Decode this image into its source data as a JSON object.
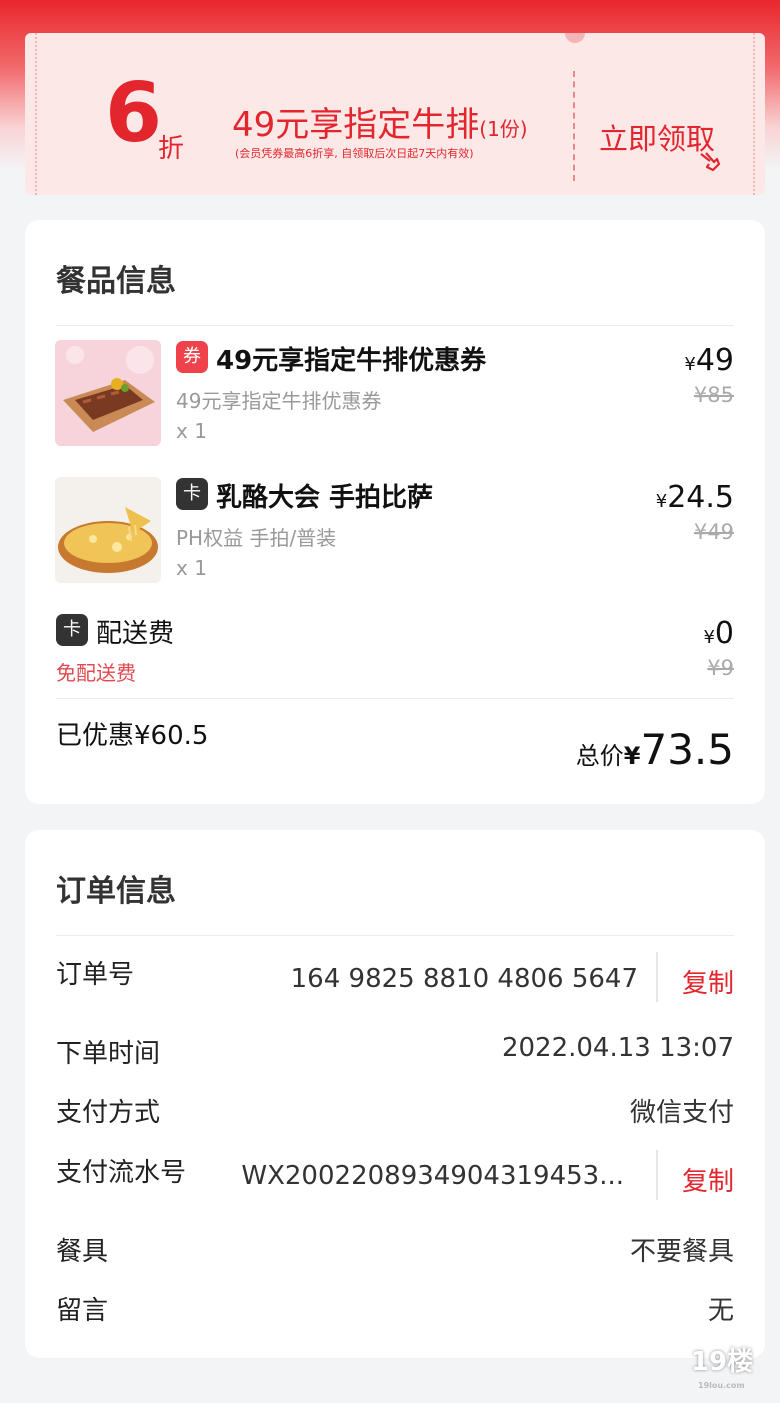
{
  "coupon": {
    "discount": "6",
    "discount_unit": "折",
    "title": "49元享指定牛排",
    "title_qty": "(1份)",
    "note": "(会员凭券最高6折享, 自领取后次日起7天内有效)",
    "claim_label": "立即领取"
  },
  "food": {
    "title": "餐品信息",
    "items": [
      {
        "badge": "券",
        "name": "49元享指定牛排优惠券",
        "subtitle": "49元享指定牛排优惠券",
        "qty": "x 1",
        "currency": "¥",
        "price": "49",
        "original_price": "¥85"
      },
      {
        "badge": "卡",
        "name": "乳酪大会 手拍比萨",
        "subtitle": "PH权益 手拍/普装",
        "qty": "x 1",
        "currency": "¥",
        "price": "24.5",
        "original_price": "¥49"
      }
    ],
    "delivery": {
      "badge": "卡",
      "name": "配送费",
      "note": "免配送费",
      "currency": "¥",
      "price": "0",
      "original_price": "¥9"
    },
    "saved": "已优惠¥60.5",
    "total_label": "总价",
    "total_currency": "¥",
    "total": "73.5"
  },
  "order": {
    "title": "订单信息",
    "order_no_label": "订单号",
    "order_no": "164 9825 8810 4806 5647",
    "copy_label": "复制",
    "time_label": "下单时间",
    "time": "2022.04.13 13:07",
    "pay_method_label": "支付方式",
    "pay_method": "微信支付",
    "pay_serial_label": "支付流水号",
    "pay_serial": "WX2002208934904319453...",
    "tableware_label": "餐具",
    "tableware": "不要餐具",
    "message_label": "留言",
    "message": "无"
  },
  "watermark": {
    "logo": "19楼",
    "domain": "19lou.com"
  },
  "colors": {
    "accent": "#e3262d",
    "card": "#ffffff",
    "background": "#f3f4f6"
  }
}
